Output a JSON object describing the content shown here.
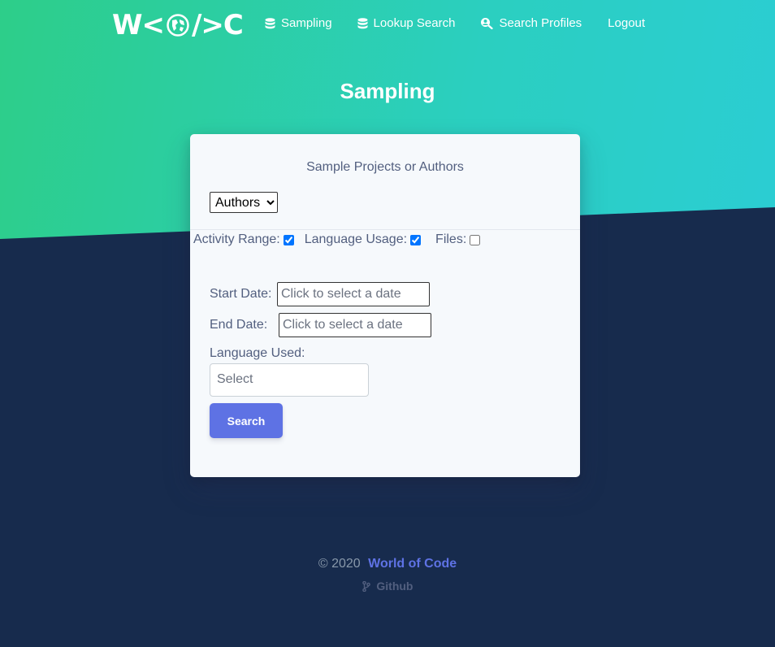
{
  "nav": {
    "logo_text_left": "W<",
    "logo_text_right": "/>C",
    "items": [
      {
        "label": "Sampling",
        "icon": "database-icon"
      },
      {
        "label": "Lookup Search",
        "icon": "database-icon"
      },
      {
        "label": "Search Profiles",
        "icon": "user-search-icon"
      },
      {
        "label": "Logout",
        "icon": ""
      }
    ]
  },
  "page": {
    "title": "Sampling"
  },
  "form": {
    "subtitle": "Sample Projects or Authors",
    "mode": {
      "selected": "Authors",
      "options": [
        "Authors"
      ]
    },
    "checkboxes": [
      {
        "label": "Activity Range:",
        "checked": true
      },
      {
        "label": "Language Usage:",
        "checked": true
      },
      {
        "label": "Files:",
        "checked": false
      }
    ],
    "start_date": {
      "label": "Start Date:",
      "placeholder": "Click to select a date"
    },
    "end_date": {
      "label": "End Date:",
      "placeholder": "Click to select a date"
    },
    "language": {
      "label": "Language Used:",
      "placeholder": "Select"
    },
    "search_label": "Search"
  },
  "footer": {
    "copyright": "© 2020",
    "brand": "World of Code",
    "github": "Github"
  },
  "colors": {
    "hero_start": "#2dce89",
    "hero_end": "#2bcdd3",
    "background": "#172b4d",
    "accent": "#5e72e4"
  }
}
